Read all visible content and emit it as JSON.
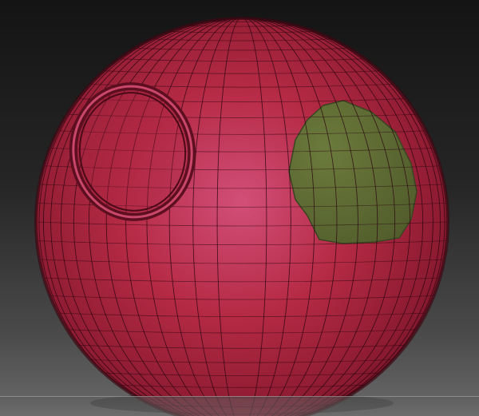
{
  "viewport": {
    "title": "",
    "background_top": "#141414",
    "background_bottom": "#6a6a6a"
  },
  "sphere": {
    "material_color": "#b52a45",
    "highlight_color": "#d4507a",
    "shadow_color": "#5a0d1c",
    "wire_color": "#2a0610",
    "polygroups": [
      {
        "name": "base",
        "color": "#b52a45"
      },
      {
        "name": "masked-patch",
        "color": "#5f6b35"
      }
    ],
    "features": [
      "inset-circle-ring",
      "polygroup-patch"
    ]
  }
}
